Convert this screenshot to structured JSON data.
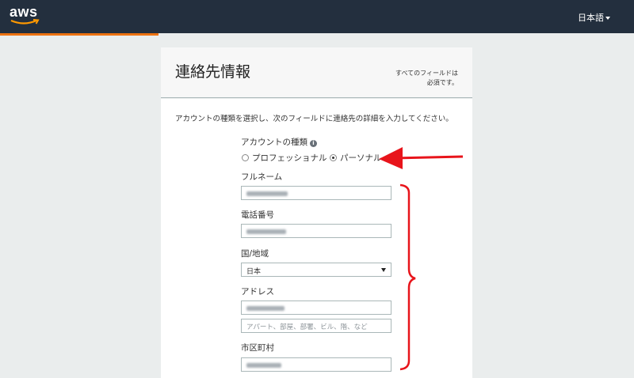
{
  "header": {
    "logo_text": "aws",
    "language": "日本語",
    "progress_fraction": 0.25,
    "accent_color": "#ec7211",
    "bar_color": "#232f3e"
  },
  "form": {
    "title": "連絡先情報",
    "required_note_line1": "すべてのフィールドは",
    "required_note_line2": "必須です。",
    "intro": "アカウントの種類を選択し、次のフィールドに連絡先の詳細を入力してください。",
    "account_type": {
      "label": "アカウントの種類",
      "info_icon": "info-icon",
      "options": [
        {
          "label": "プロフェッショナル",
          "selected": false
        },
        {
          "label": "パーソナル",
          "selected": true
        }
      ]
    },
    "full_name": {
      "label": "フルネーム",
      "value_blurred": true
    },
    "phone": {
      "label": "電話番号",
      "value_blurred": true
    },
    "country": {
      "label": "国/地域",
      "value": "日本"
    },
    "address": {
      "label": "アドレス",
      "line1_blurred": true,
      "line2_placeholder": "アパート、部屋、部署、ビル、階、など"
    },
    "city": {
      "label": "市区町村",
      "value_blurred": true
    }
  },
  "annotations": {
    "arrow_color": "#e8141b",
    "arrow_target": "personal-radio",
    "brace_target": "contact-fields"
  }
}
